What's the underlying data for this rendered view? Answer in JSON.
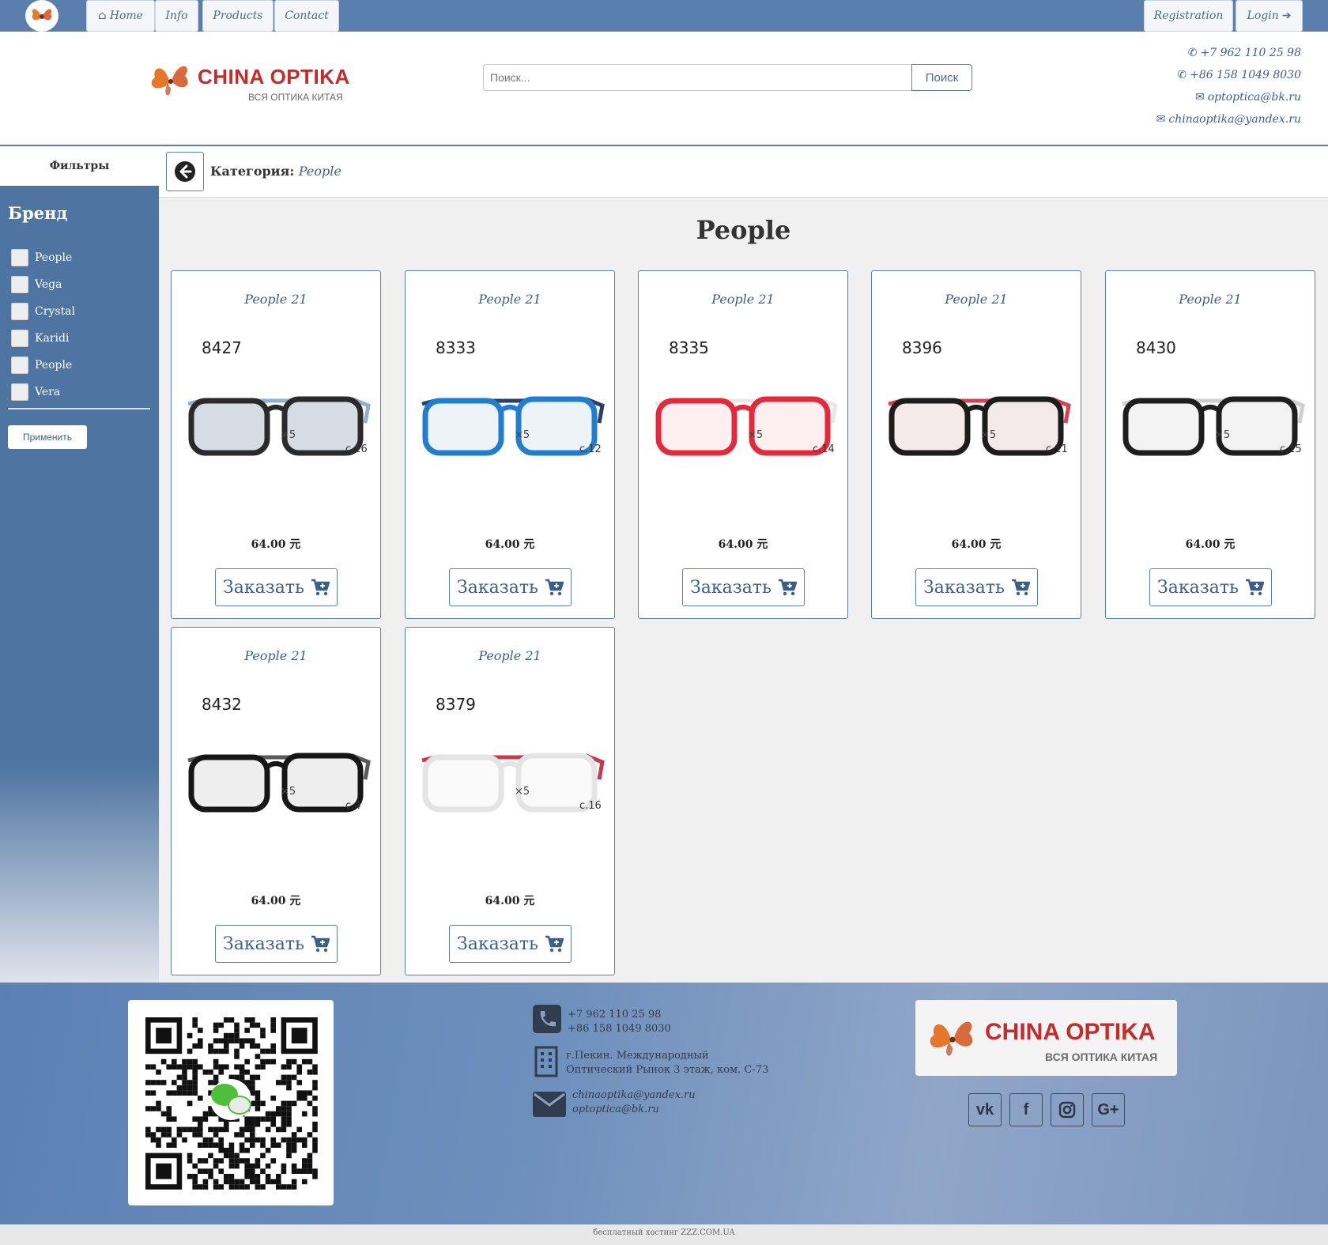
{
  "navbar": {
    "home_label": "Home",
    "info_label": "Info",
    "products_label": "Products",
    "contact_label": "Contact",
    "registration_label": "Registration",
    "login_label": "Login"
  },
  "header": {
    "brand_title": "CHINA OPTIKA",
    "brand_subtitle": "ВСЯ ОПТИКА КИТАЯ",
    "search_placeholder": "Поиск...",
    "search_button": "Поиск",
    "phone1": "+7 962 110 25 98",
    "phone2": "+86 158 1049 8030",
    "email1": "optoptica@bk.ru",
    "email2": "chinaoptika@yandex.ru"
  },
  "sidebar": {
    "filters_label": "Фильтры",
    "brand_heading": "Бренд",
    "brands": [
      "People",
      "Vega",
      "Crystal",
      "Karidi",
      "People",
      "Vera"
    ],
    "apply_label": "Применить"
  },
  "breadcrumb": {
    "label": "Категория:",
    "value": "People"
  },
  "page_title": "People",
  "products": [
    {
      "name": "People 21",
      "model": "8427",
      "pack": "×5",
      "cs": "c.16",
      "price": "64.00 元",
      "order": "Заказать",
      "color": "dark"
    },
    {
      "name": "People 21",
      "model": "8333",
      "pack": "×5",
      "cs": "c.12",
      "price": "64.00 元",
      "order": "Заказать",
      "color": "blue"
    },
    {
      "name": "People 21",
      "model": "8335",
      "pack": "×5",
      "cs": "c.14",
      "price": "64.00 元",
      "order": "Заказать",
      "color": "red"
    },
    {
      "name": "People 21",
      "model": "8396",
      "pack": "×5",
      "cs": "c.11",
      "price": "64.00 元",
      "order": "Заказать",
      "color": "cat"
    },
    {
      "name": "People 21",
      "model": "8430",
      "pack": "×5",
      "cs": "c.15",
      "price": "64.00 元",
      "order": "Заказать",
      "color": "clear"
    },
    {
      "name": "People 21",
      "model": "8432",
      "pack": "×5",
      "cs": "c.4",
      "price": "64.00 元",
      "order": "Заказать",
      "color": "black"
    },
    {
      "name": "People 21",
      "model": "8379",
      "pack": "×5",
      "cs": "c.16",
      "price": "64.00 元",
      "order": "Заказать",
      "color": "white"
    }
  ],
  "footer": {
    "phone1": "+7 962 110 25 98",
    "phone2": "+86 158 1049 8030",
    "address1": "г.Пекин. Международный",
    "address2": "Оптический Рынок 3 этаж, ком. C-73",
    "email1": "chinaoptika@yandex.ru",
    "email2": "optoptica@bk.ru",
    "brand_title": "CHINA OPTIKA",
    "brand_subtitle": "ВСЯ ОПТИКА КИТАЯ",
    "social": [
      "vk-icon",
      "facebook-icon",
      "instagram-icon",
      "google-plus-icon"
    ],
    "hosting": "бесплатный хостинг ZZZ.COM.UA"
  },
  "colors": {
    "nav_blue": "#5a7fae",
    "brand_red": "#c82a2a",
    "link_blue": "#3b5f8a"
  }
}
